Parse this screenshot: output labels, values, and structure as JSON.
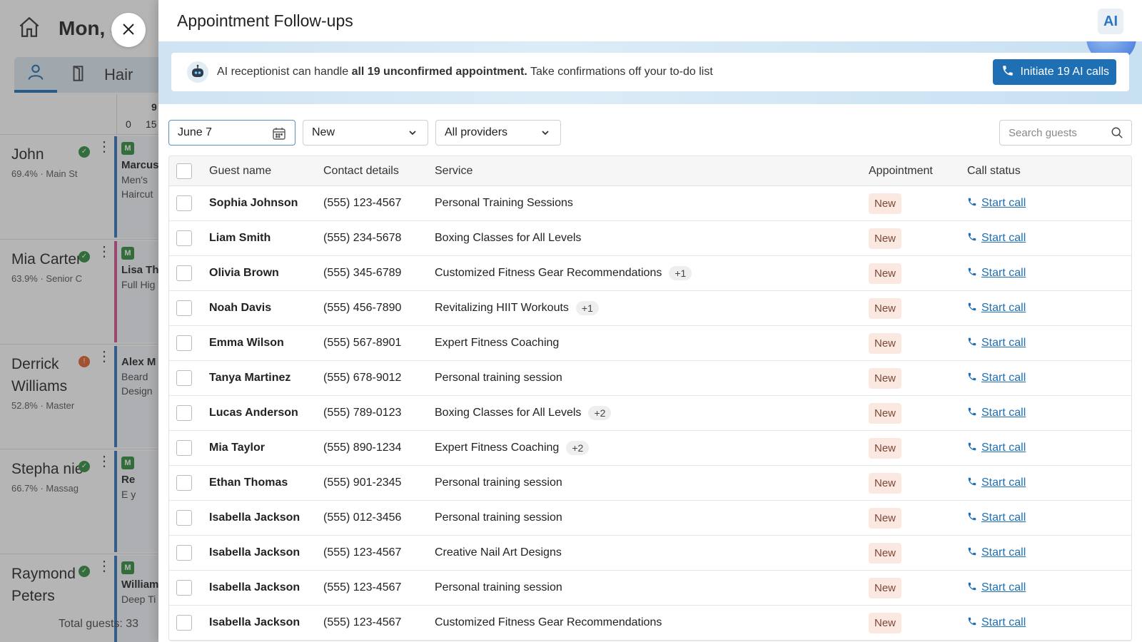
{
  "background": {
    "date_title": "Mon, J",
    "tab_label": "Hair",
    "time_header": {
      "hour": "9",
      "m0": "0",
      "m15": "15"
    },
    "staff": [
      {
        "name": "John",
        "meta": "69.4% · Main St",
        "status": "ok"
      },
      {
        "name": "Mia Carter",
        "meta": "63.9% · Senior C",
        "status": "ok"
      },
      {
        "name": "Derrick Williams",
        "meta": "52.8% · Master",
        "status": "warn"
      },
      {
        "name": "Stepha nie",
        "meta": "66.7% · Massag",
        "status": "ok"
      },
      {
        "name": "Raymond Peters",
        "meta": "",
        "status": "ok"
      }
    ],
    "appointments": [
      {
        "badge": "M",
        "name": "Marcus",
        "desc": "Men's Haircut",
        "color": "#2c73b8"
      },
      {
        "badge": "M",
        "name": "Lisa Th",
        "desc": "Full Hig",
        "color": "#d64f8f"
      },
      {
        "badge": "",
        "name": "Alex M",
        "desc": "Beard Design",
        "color": "#2c73b8"
      },
      {
        "badge": "M",
        "name": "Re",
        "desc": "E y",
        "color": "#2c73b8"
      },
      {
        "badge": "M",
        "name": "William",
        "desc": "Deep Ti",
        "color": "#2c73b8"
      }
    ],
    "footer": "Total guests: 33"
  },
  "drawer": {
    "title": "Appointment Follow-ups",
    "ai_logo": "AI",
    "banner": {
      "pre": "AI receptionist can handle ",
      "bold": "all 19 unconfirmed appointment.",
      "post": " Take confirmations off your to-do list",
      "button": "Initiate 19 AI calls"
    },
    "filters": {
      "date": "June 7",
      "status": "New",
      "providers": "All providers",
      "search_placeholder": "Search guests"
    },
    "columns": {
      "name": "Guest name",
      "contact": "Contact details",
      "service": "Service",
      "appointment": "Appointment",
      "call": "Call status"
    },
    "rows": [
      {
        "name": "Sophia Johnson",
        "phone": "(555) 123-4567",
        "service": "Personal Training Sessions",
        "extra": "",
        "appt": "New",
        "call": "Start call"
      },
      {
        "name": "Liam Smith",
        "phone": "(555) 234-5678",
        "service": "Boxing Classes for All Levels",
        "extra": "",
        "appt": "New",
        "call": "Start call"
      },
      {
        "name": "Olivia Brown",
        "phone": "(555) 345-6789",
        "service": "Customized Fitness Gear Recommendations",
        "extra": "+1",
        "appt": "New",
        "call": "Start call"
      },
      {
        "name": "Noah Davis",
        "phone": "(555) 456-7890",
        "service": "Revitalizing HIIT Workouts",
        "extra": "+1",
        "appt": "New",
        "call": "Start call"
      },
      {
        "name": "Emma Wilson",
        "phone": "(555) 567-8901",
        "service": "Expert Fitness Coaching",
        "extra": "",
        "appt": "New",
        "call": "Start call"
      },
      {
        "name": "Tanya Martinez",
        "phone": "(555) 678-9012",
        "service": "Personal training session",
        "extra": "",
        "appt": "New",
        "call": "Start call"
      },
      {
        "name": "Lucas Anderson",
        "phone": "(555) 789-0123",
        "service": "Boxing Classes for All Levels",
        "extra": "+2",
        "appt": "New",
        "call": "Start call"
      },
      {
        "name": "Mia Taylor",
        "phone": "(555) 890-1234",
        "service": "Expert Fitness Coaching",
        "extra": "+2",
        "appt": "New",
        "call": "Start call"
      },
      {
        "name": "Ethan Thomas",
        "phone": "(555) 901-2345",
        "service": "Personal training session",
        "extra": "",
        "appt": "New",
        "call": "Start call"
      },
      {
        "name": "Isabella Jackson",
        "phone": "(555) 012-3456",
        "service": "Personal training session",
        "extra": "",
        "appt": "New",
        "call": "Start call"
      },
      {
        "name": "Isabella Jackson",
        "phone": "(555) 123-4567",
        "service": "Creative Nail Art Designs",
        "extra": "",
        "appt": "New",
        "call": "Start call"
      },
      {
        "name": "Isabella Jackson",
        "phone": "(555) 123-4567",
        "service": "Personal training session",
        "extra": "",
        "appt": "New",
        "call": "Start call"
      },
      {
        "name": "Isabella Jackson",
        "phone": "(555) 123-4567",
        "service": "Customized Fitness Gear Recommendations",
        "extra": "",
        "appt": "New",
        "call": "Start call"
      }
    ]
  },
  "colors": {
    "accent": "#1f6fb5",
    "badge_bg": "#fbe9e1",
    "status_ok": "#2e8b3d",
    "status_warn": "#e0602a"
  },
  "icons": [
    "home-icon",
    "close-icon",
    "person-icon",
    "door-icon",
    "ai-logo-icon",
    "robot-icon",
    "phone-icon",
    "calendar-icon",
    "chevron-down-icon",
    "search-icon"
  ]
}
